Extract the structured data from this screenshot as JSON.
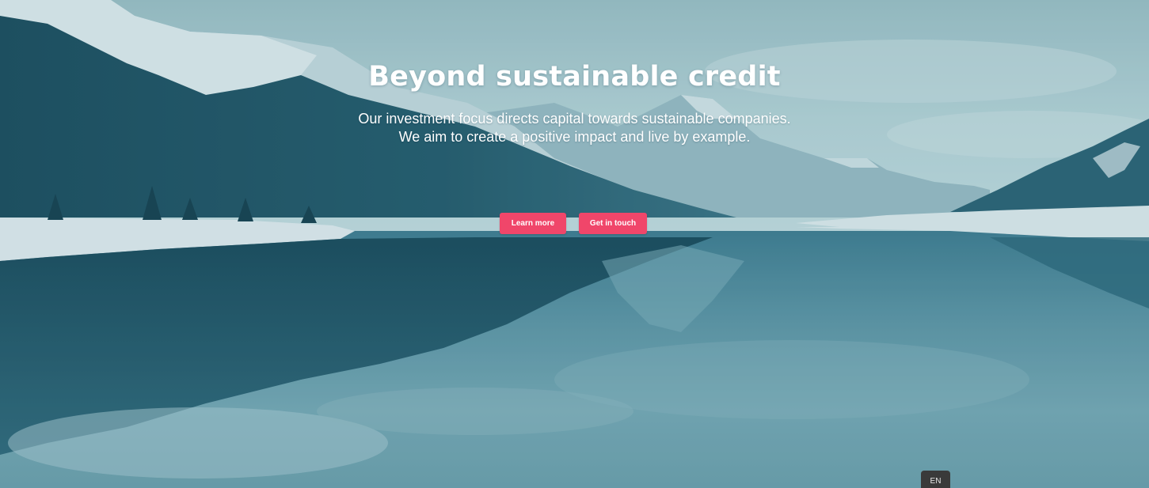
{
  "hero": {
    "title": "Beyond sustainable credit",
    "subtitle_line1": "Our investment focus directs capital towards sustainable companies.",
    "subtitle_line2": "We aim to create a positive impact and live by example.",
    "background": "mountain-lake-landscape",
    "tint_color": "#2f6b80"
  },
  "buttons": {
    "learn_more": "Learn more",
    "get_in_touch": "Get in touch",
    "color": "#f0466a"
  },
  "language": {
    "current": "EN"
  }
}
